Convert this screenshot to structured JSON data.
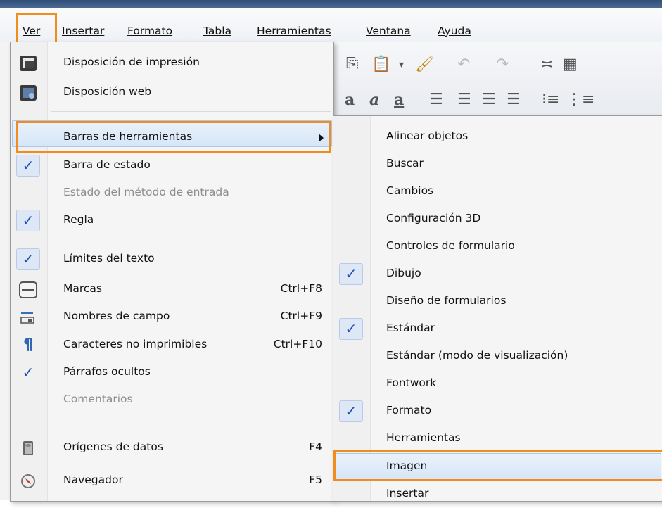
{
  "menubar": {
    "items": [
      "Ver",
      "Insertar",
      "Formato",
      "Tabla",
      "Herramientas",
      "Ventana",
      "Ayuda"
    ]
  },
  "view_menu": {
    "items": [
      {
        "label": "Disposición de impresión",
        "icon": "print-layout-icon"
      },
      {
        "label": "Disposición web",
        "icon": "web-layout-icon"
      },
      {
        "label": "Barras de herramientas",
        "submenu": true
      },
      {
        "label": "Barra de estado",
        "checked": true
      },
      {
        "label": "Estado del método de entrada",
        "disabled": true
      },
      {
        "label": "Regla",
        "checked": true
      },
      {
        "label": "Límites del texto",
        "checked": true
      },
      {
        "label": "Marcas",
        "shortcut": "Ctrl+F8",
        "icon": "field-shadings-icon"
      },
      {
        "label": "Nombres de campo",
        "shortcut": "Ctrl+F9",
        "icon": "field-names-icon"
      },
      {
        "label": "Caracteres no imprimibles",
        "shortcut": "Ctrl+F10",
        "icon": "pilcrow-icon"
      },
      {
        "label": "Párrafos ocultos",
        "checked": true
      },
      {
        "label": "Comentarios",
        "disabled": true
      },
      {
        "label": "Orígenes de datos",
        "shortcut": "F4",
        "icon": "data-sources-icon"
      },
      {
        "label": "Navegador",
        "shortcut": "F5",
        "icon": "navigator-icon"
      }
    ]
  },
  "toolbars_submenu": {
    "items": [
      {
        "label": "Alinear objetos"
      },
      {
        "label": "Buscar"
      },
      {
        "label": "Cambios"
      },
      {
        "label": "Configuración 3D"
      },
      {
        "label": "Controles de formulario"
      },
      {
        "label": "Dibujo",
        "checked": true
      },
      {
        "label": "Diseño de formularios"
      },
      {
        "label": "Estándar",
        "checked": true
      },
      {
        "label": "Estándar (modo de visualización)"
      },
      {
        "label": "Fontwork"
      },
      {
        "label": "Formato",
        "checked": true
      },
      {
        "label": "Herramientas"
      },
      {
        "label": "Imagen",
        "highlighted": true
      },
      {
        "label": "Insertar"
      }
    ]
  },
  "colors": {
    "highlight_box": "#f18c1e",
    "check": "#1a4fb0",
    "disabled": "#8d8d8d"
  }
}
